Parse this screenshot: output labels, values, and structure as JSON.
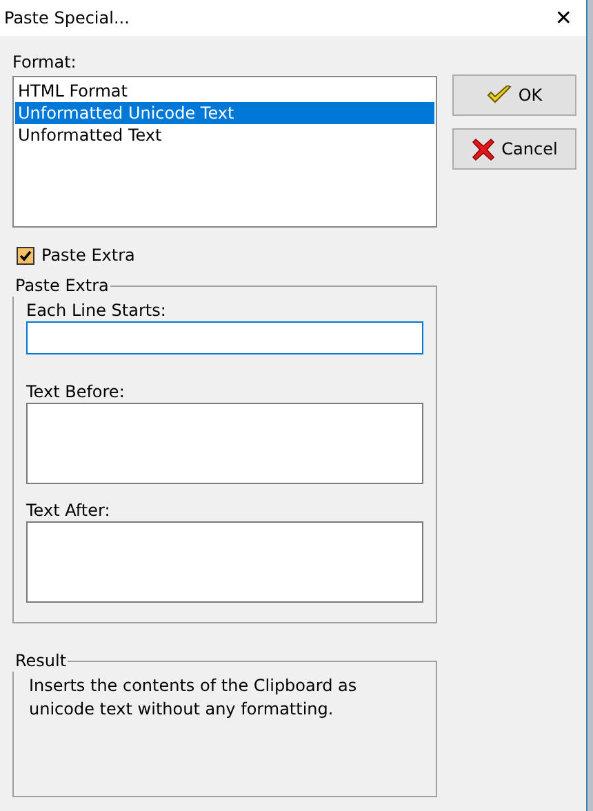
{
  "window": {
    "title": "Paste Special...",
    "close": "✕"
  },
  "format": {
    "label": "Format:",
    "items": [
      {
        "label": "HTML Format",
        "selected": false
      },
      {
        "label": "Unformatted Unicode Text",
        "selected": true
      },
      {
        "label": "Unformatted Text",
        "selected": false
      }
    ]
  },
  "buttons": [
    {
      "kind": "ok",
      "label": "OK"
    },
    {
      "kind": "cancel",
      "label": "Cancel"
    }
  ],
  "paste_extra_checkbox": {
    "label": "Paste Extra",
    "checked": true
  },
  "paste_extra_group": {
    "title": "Paste Extra",
    "fields": [
      {
        "label": "Each Line Starts:",
        "kind": "line",
        "focused": true
      },
      {
        "label": "Text Before:",
        "kind": "area",
        "focused": false
      },
      {
        "label": "Text After:",
        "kind": "area",
        "focused": false
      }
    ]
  },
  "result": {
    "title": "Result",
    "text": "Inserts the contents of the Clipboard as unicode text without any formatting."
  }
}
